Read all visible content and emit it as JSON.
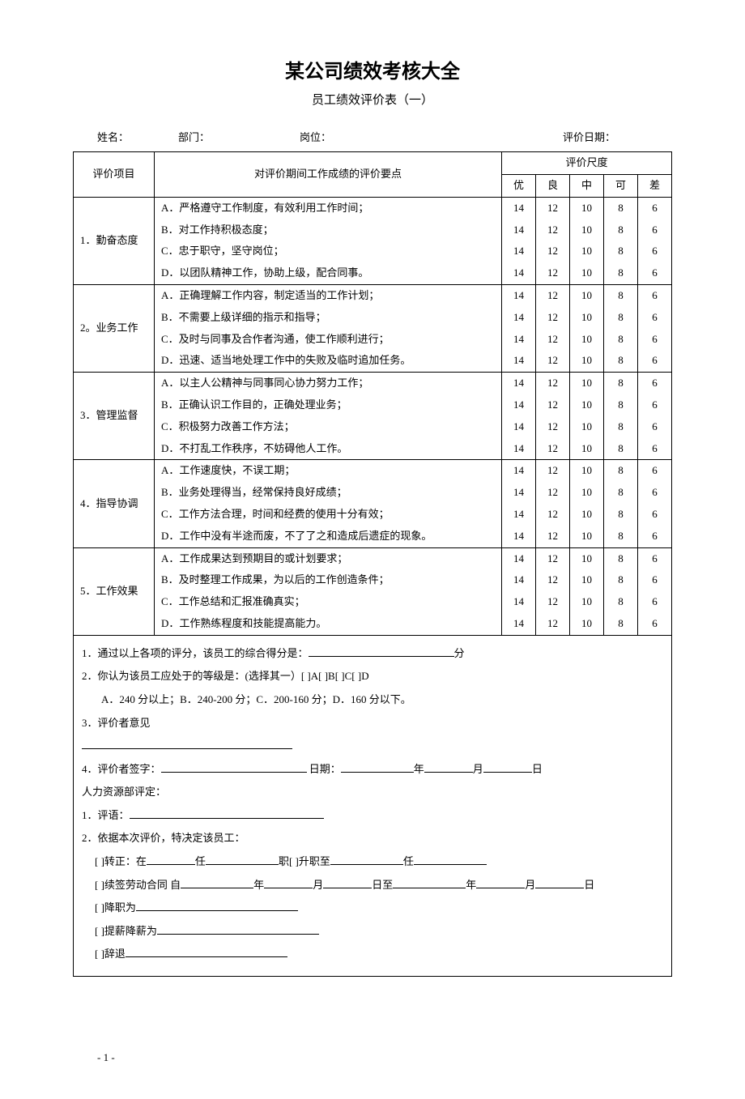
{
  "title": "某公司绩效考核大全",
  "subtitle": "员工绩效评价表（一）",
  "info": {
    "name_label": "姓名：",
    "dept_label": "部门：",
    "pos_label": "岗位：",
    "date_label": "评价日期："
  },
  "headers": {
    "category": "评价项目",
    "criteria": "对评价期间工作成绩的评价要点",
    "scale": "评价尺度",
    "s1": "优",
    "s2": "良",
    "s3": "中",
    "s4": "可",
    "s5": "差"
  },
  "scores": [
    "14",
    "12",
    "10",
    "8",
    "6"
  ],
  "categories": [
    {
      "name": "1．勤奋态度",
      "items": [
        "A．严格遵守工作制度，有效利用工作时间；",
        "B．对工作持积极态度；",
        "C．忠于职守，坚守岗位；",
        "D．以团队精神工作，协助上级，配合同事。"
      ]
    },
    {
      "name": "2。业务工作",
      "items": [
        "A．正确理解工作内容，制定适当的工作计划；",
        "B．不需要上级详细的指示和指导；",
        "C．及时与同事及合作者沟通，使工作顺利进行；",
        "D．迅速、适当地处理工作中的失败及临时追加任务。"
      ]
    },
    {
      "name": "3．管理监督",
      "items": [
        "A．以主人公精神与同事同心协力努力工作；",
        "B．正确认识工作目的，正确处理业务；",
        "C．积极努力改善工作方法；",
        "D．不打乱工作秩序，不妨碍他人工作。"
      ]
    },
    {
      "name": "4．指导协调",
      "items": [
        "A．工作速度快，不误工期；",
        "B．业务处理得当，经常保持良好成绩；",
        "C．工作方法合理，时间和经费的使用十分有效；",
        "D．工作中没有半途而废，不了了之和造成后遗症的现象。"
      ]
    },
    {
      "name": "5．工作效果",
      "items": [
        "A．工作成果达到预期目的或计划要求；",
        "B．及时整理工作成果，为以后的工作创造条件；",
        "C．工作总结和汇报准确真实；",
        "D．工作熟练程度和技能提高能力。"
      ]
    }
  ],
  "footer": {
    "line1a": "1．通过以上各项的评分，该员工的综合得分是：",
    "line1b": "分",
    "line2": "2．你认为该员工应处于的等级是：(选择其一）[   ]A[   ]B[   ]C[   ]D",
    "line2b": "A．240 分以上；B．240-200 分；C．200-160 分；D．160 分以下。",
    "line3": "3．评价者意见",
    "line4a": "4．评价者签字：",
    "line4b": " 日期：",
    "line4c": "年",
    "line4d": "月",
    "line4e": "日",
    "hr_label": "人力资源部评定：",
    "hr1": "1．评语：",
    "hr2": "2．依据本次评价，特决定该员工：",
    "opt1a": "[   ]转正：在",
    "opt1b": "任",
    "opt1c": "职[   ]升职至",
    "opt1d": "任",
    "opt2a": "[   ]续签劳动合同  自",
    "opt2b": "年",
    "opt2c": "月",
    "opt2d": "日至",
    "opt2e": "年",
    "opt2f": "月",
    "opt2g": "日",
    "opt3": "[   ]降职为",
    "opt4": "[   ]提薪降薪为",
    "opt5": "[   ]辞退"
  },
  "page_num": "- 1 -"
}
